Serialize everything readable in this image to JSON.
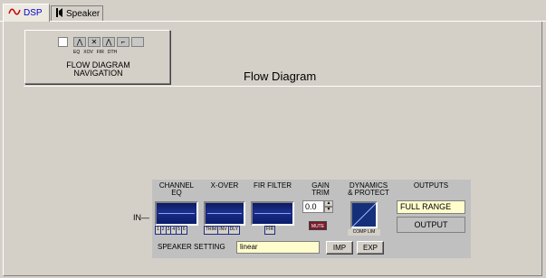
{
  "tabs": [
    {
      "label": "DSP",
      "icon": "dsp-wave-icon",
      "active": true
    },
    {
      "label": "Speaker",
      "icon": "speaker-icon",
      "active": false
    }
  ],
  "nav": {
    "title_line1": "FLOW DIAGRAM",
    "title_line2": "NAVIGATION",
    "icon_labels": [
      "EQ",
      "XOV",
      "FIR",
      "DTH"
    ]
  },
  "flow_title": "Flow Diagram",
  "in_label": "IN",
  "stages": {
    "channel_eq": {
      "line1": "CHANNEL",
      "line2": "EQ",
      "buttons": [
        "1",
        "2",
        "3",
        "4",
        "5",
        "6"
      ]
    },
    "xover": {
      "line1": "X-OVER",
      "buttons": [
        "TRIM",
        "INV",
        "DLY"
      ]
    },
    "fir": {
      "line1": "FIR FILTER",
      "buttons": [
        "FIR"
      ]
    },
    "gain": {
      "line1": "GAIN",
      "line2": "TRIM",
      "value": "0.0",
      "mute": "MUTE"
    },
    "dynamics": {
      "line1": "DYNAMICS",
      "line2": "& PROTECT",
      "button": "COMP LIM"
    },
    "outputs": {
      "line1": "OUTPUTS",
      "mode": "FULL RANGE",
      "button": "OUTPUT"
    }
  },
  "speaker_setting": {
    "label": "SPEAKER SETTING",
    "value": "linear",
    "imp": "IMP",
    "exp": "EXP"
  },
  "colors": {
    "panel": "#d4d0c8",
    "screen": "#1b2f8a",
    "mute": "#7a1a2a",
    "field": "#fffdcc"
  }
}
